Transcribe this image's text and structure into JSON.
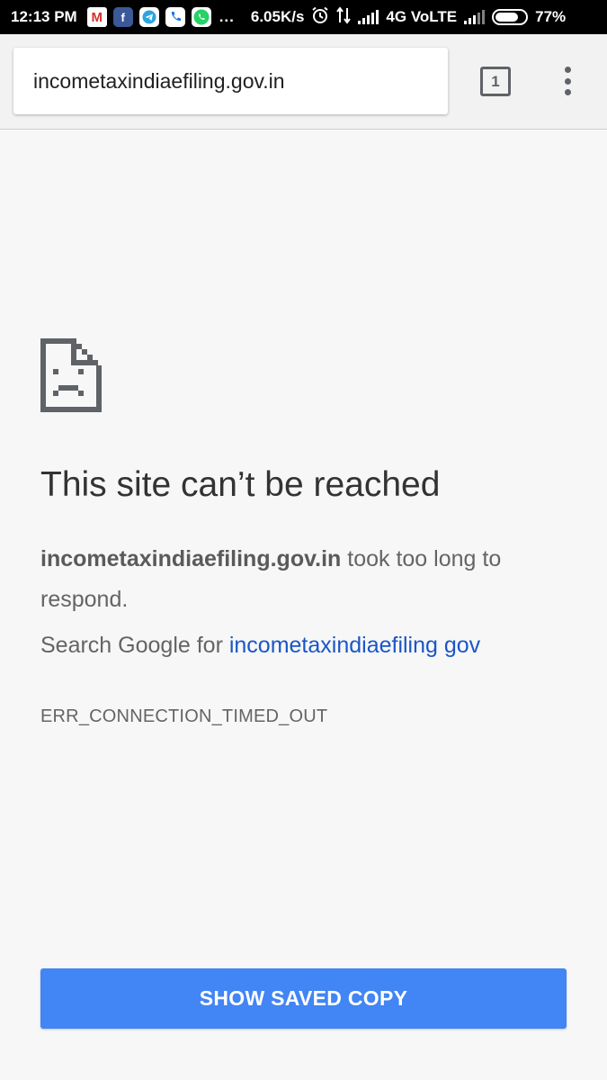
{
  "status_bar": {
    "time": "12:13 PM",
    "notifications": [
      "gmail-icon",
      "facebook-icon",
      "telegram-icon",
      "phone-icon",
      "whatsapp-icon"
    ],
    "more": "...",
    "net_speed": "6.05K/s",
    "network": "4G VoLTE",
    "battery": "77%",
    "battery_level": 0.77
  },
  "toolbar": {
    "url": "incometaxindiaefiling.gov.in",
    "tab_count": "1"
  },
  "error": {
    "title": "This site can’t be reached",
    "host": "incometaxindiaefiling.gov.in",
    "message": " took too long to respond.",
    "search_prefix": "Search Google for ",
    "search_query": "incometaxindiaefiling gov",
    "code": "ERR_CONNECTION_TIMED_OUT"
  },
  "button": {
    "label": "SHOW SAVED COPY"
  },
  "colors": {
    "button": "#4285f4",
    "link": "#1a56c7",
    "background": "#f7f7f7"
  }
}
